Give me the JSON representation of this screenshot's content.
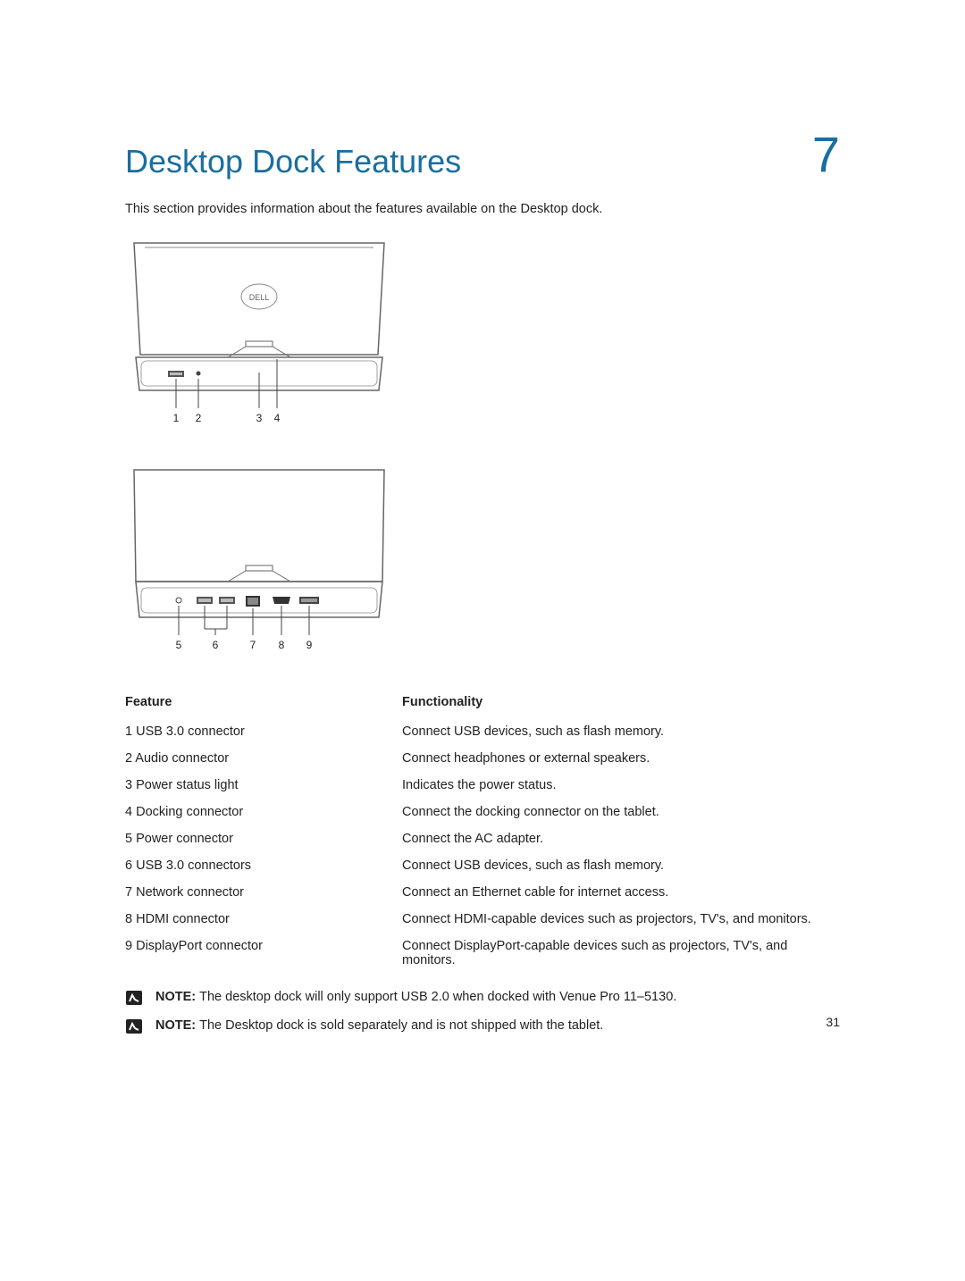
{
  "chapter_number": "7",
  "title": "Desktop Dock Features",
  "intro": "This section provides information about the features available on the Desktop dock.",
  "table": {
    "header_feature": "Feature",
    "header_functionality": "Functionality",
    "rows": [
      {
        "num": "1",
        "feature": "USB 3.0 connector",
        "functionality": "Connect USB devices, such as flash memory."
      },
      {
        "num": "2",
        "feature": "Audio connector",
        "functionality": "Connect headphones or external speakers."
      },
      {
        "num": "3",
        "feature": "Power status light",
        "functionality": "Indicates the power status."
      },
      {
        "num": "4",
        "feature": "Docking connector",
        "functionality": "Connect the docking connector on the tablet."
      },
      {
        "num": "5",
        "feature": "Power connector",
        "functionality": "Connect the AC adapter."
      },
      {
        "num": "6",
        "feature": "USB 3.0 connectors",
        "functionality": "Connect USB devices, such as flash memory."
      },
      {
        "num": "7",
        "feature": "Network connector",
        "functionality": "Connect an Ethernet cable for internet access."
      },
      {
        "num": "8",
        "feature": "HDMI connector",
        "functionality": "Connect HDMI-capable devices such as projectors, TV's, and monitors."
      },
      {
        "num": "9",
        "feature": "DisplayPort connector",
        "functionality": "Connect DisplayPort-capable devices such as projectors, TV's, and monitors."
      }
    ]
  },
  "diagram_front": {
    "logo": "DELL",
    "callouts": [
      "1",
      "2",
      "3",
      "4"
    ]
  },
  "diagram_back": {
    "callouts": [
      "5",
      "6",
      "7",
      "8",
      "9"
    ]
  },
  "notes": {
    "label": "NOTE:",
    "items": [
      "The desktop dock will only support USB 2.0 when docked with Venue Pro 11–5130.",
      "The Desktop dock is sold separately and is not shipped with the tablet."
    ]
  },
  "page_number": "31"
}
